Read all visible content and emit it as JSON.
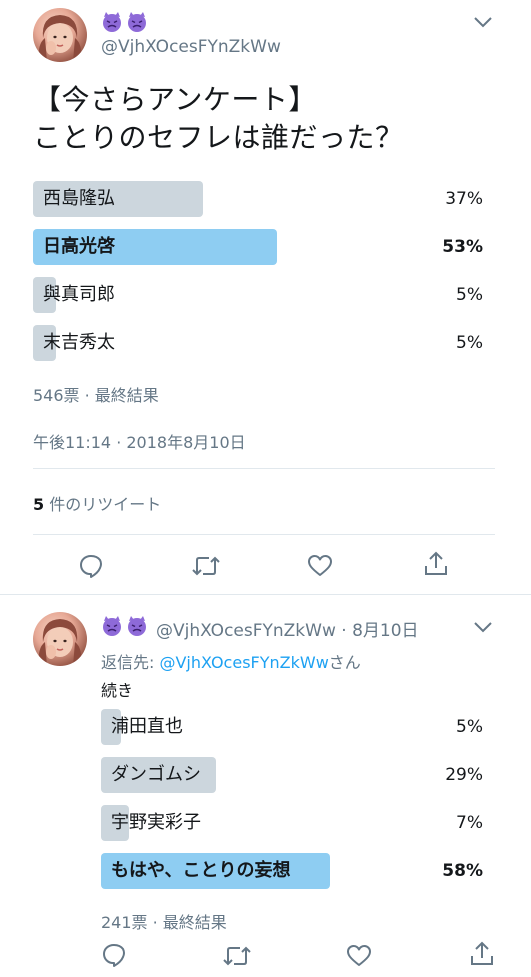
{
  "tweet1": {
    "emojis": "😈😈",
    "handle": "@VjhXOcesFYnZkWw",
    "text_line1": "【今さらアンケート】",
    "text_line2": "ことりのセフレは誰だった？",
    "poll": [
      {
        "label": "西島隆弘",
        "percent_text": "37%",
        "value": 37,
        "winner": false
      },
      {
        "label": "日高光啓",
        "percent_text": "53%",
        "value": 53,
        "winner": true
      },
      {
        "label": "與真司郎",
        "percent_text": "5%",
        "value": 5,
        "winner": false
      },
      {
        "label": "末吉秀太",
        "percent_text": "5%",
        "value": 5,
        "winner": false
      }
    ],
    "votes": "546票 · 最終結果",
    "timestamp": "午後11:14 · 2018年8月10日",
    "rt_count": "5",
    "rt_label": "件のリツイート"
  },
  "tweet2": {
    "emojis": "😈😈",
    "handle_date": "@VjhXOcesFYnZkWw · 8月10日",
    "reply_prefix": "返信先: ",
    "reply_mention": "@VjhXOcesFYnZkWw",
    "reply_suffix": "さん",
    "text": "続き",
    "poll": [
      {
        "label": "浦田直也",
        "percent_text": "5%",
        "value": 5,
        "winner": false
      },
      {
        "label": "ダンゴムシ",
        "percent_text": "29%",
        "value": 29,
        "winner": false
      },
      {
        "label": "宇野実彩子",
        "percent_text": "7%",
        "value": 7,
        "winner": false
      },
      {
        "label": "もはや、ことりの妄想",
        "percent_text": "58%",
        "value": 58,
        "winner": true
      }
    ],
    "votes": "241票 · 最終結果"
  },
  "icons": [
    "avatar",
    "devil-emoji",
    "chevron-down-icon",
    "reply-icon",
    "retweet-icon",
    "like-icon",
    "share-icon"
  ],
  "colors": {
    "accent": "#1da1f2",
    "winner_bar": "#8ecdf2",
    "bar": "#ccd6dd",
    "muted": "#657786",
    "divider": "#e1e8ed"
  }
}
